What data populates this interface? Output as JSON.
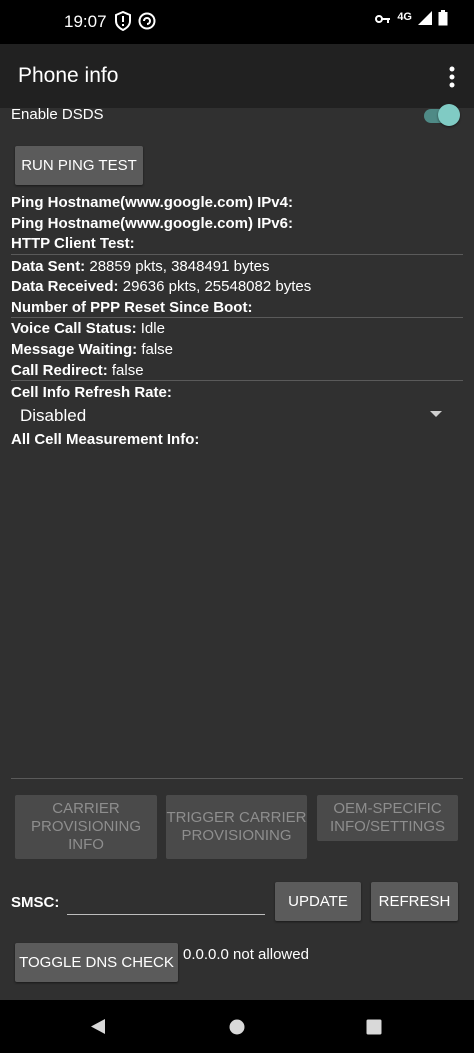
{
  "status_bar": {
    "time": "19:07",
    "network": "4G",
    "icons": [
      "shield-alert-icon",
      "vpn-key-icon",
      "signal-icon",
      "battery-icon"
    ]
  },
  "app_bar": {
    "title": "Phone info",
    "overflow_icon": "more-vert-icon"
  },
  "dsds": {
    "label": "Enable DSDS",
    "enabled": true
  },
  "ping": {
    "button_label": "RUN PING TEST",
    "ipv4_label": "Ping Hostname(www.google.com) IPv4:",
    "ipv6_label": "Ping Hostname(www.google.com) IPv6:",
    "http_label": "HTTP Client Test:"
  },
  "data_stats": {
    "sent_label": "Data Sent:",
    "sent_value": "28859 pkts, 3848491 bytes",
    "received_label": "Data Received:",
    "received_value": "29636 pkts, 25548082 bytes",
    "ppp_label": "Number of PPP Reset Since Boot:"
  },
  "call_status": {
    "voice_label": "Voice Call Status:",
    "voice_value": "Idle",
    "message_label": "Message Waiting:",
    "message_value": "false",
    "redirect_label": "Call Redirect:",
    "redirect_value": "false"
  },
  "cell_info": {
    "refresh_label": "Cell Info Refresh Rate:",
    "refresh_value": "Disabled",
    "measurement_label": "All Cell Measurement Info:"
  },
  "actions": {
    "carrier_provisioning": "CARRIER PROVISIONING INFO",
    "trigger_provisioning": "TRIGGER CARRIER PROVISIONING",
    "oem_settings": "OEM-SPECIFIC INFO/SETTINGS"
  },
  "smsc": {
    "label": "SMSC:",
    "value": "",
    "update_label": "UPDATE",
    "refresh_label": "REFRESH"
  },
  "dns": {
    "button_label": "TOGGLE DNS CHECK",
    "status": "0.0.0.0 not allowed"
  },
  "nav": [
    "back-icon",
    "home-icon",
    "recents-icon"
  ],
  "colors": {
    "background": "#303030",
    "app_bar": "#212121",
    "accent": "#80cbc4",
    "button": "#5b5b5b"
  }
}
